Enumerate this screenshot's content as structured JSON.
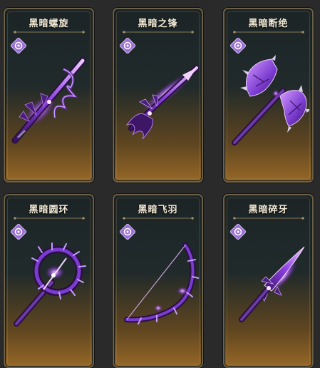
{
  "cards": [
    {
      "name": "黑暗螺旋",
      "weapon_type": "greatsword-icon",
      "badge_icon": "dark-element-icon"
    },
    {
      "name": "黑暗之锋",
      "weapon_type": "spear-icon",
      "badge_icon": "dark-element-icon"
    },
    {
      "name": "黑暗断绝",
      "weapon_type": "double-axe-icon",
      "badge_icon": "dark-element-icon"
    },
    {
      "name": "黑暗圆环",
      "weapon_type": "staff-icon",
      "badge_icon": "dark-element-icon"
    },
    {
      "name": "黑暗飞羽",
      "weapon_type": "bow-icon",
      "badge_icon": "dark-element-icon"
    },
    {
      "name": "黑暗碎牙",
      "weapon_type": "dagger-icon",
      "badge_icon": "dark-element-icon"
    }
  ],
  "colors": {
    "frame": "#6b6148",
    "title": "#f2ead6",
    "badge": "#9b6fd6",
    "weapon_primary": "#7a3bd0",
    "weapon_glow": "#e7b8ff",
    "card_glow_bottom": "#b07628"
  }
}
